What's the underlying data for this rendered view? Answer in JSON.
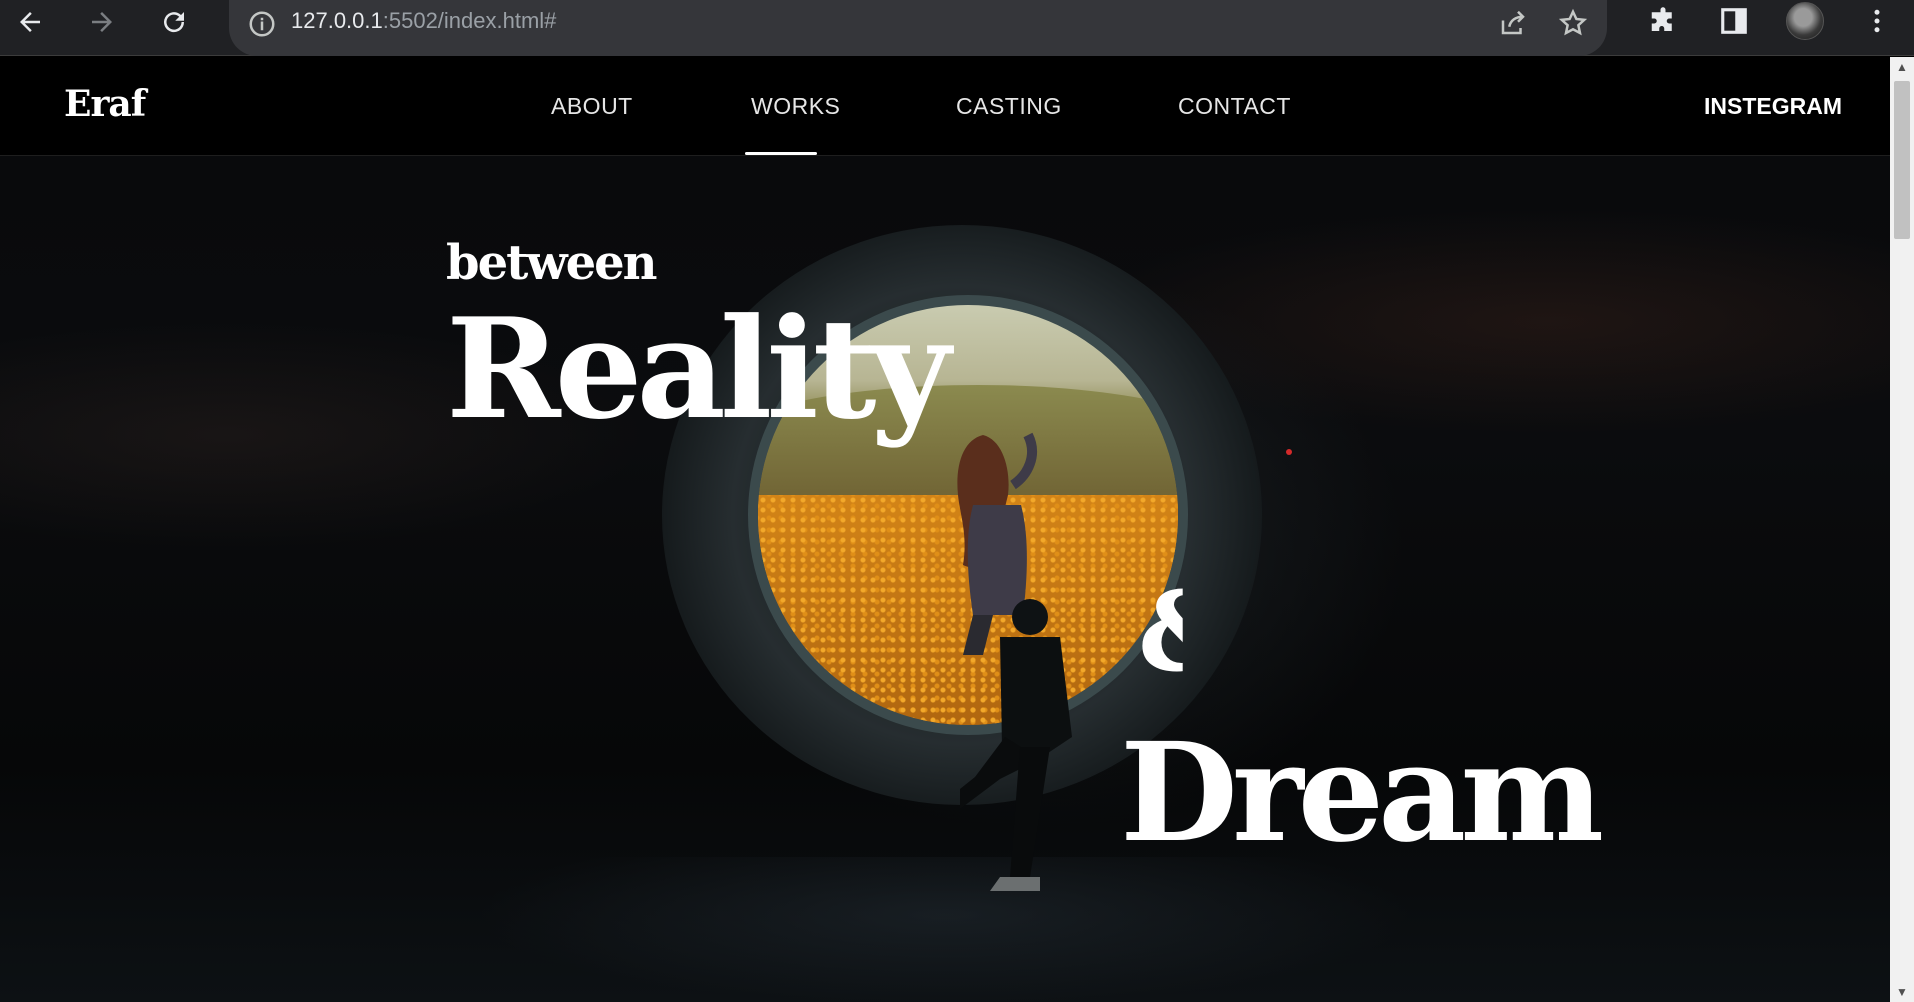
{
  "browser": {
    "url_host": "127.0.0.1",
    "url_rest": ":5502/index.html#",
    "icons": [
      "back-icon",
      "forward-icon",
      "reload-icon",
      "info-icon",
      "share-icon",
      "star-icon",
      "extensions-icon",
      "sidepanel-icon",
      "profile-avatar",
      "menu-icon"
    ]
  },
  "site": {
    "logo": "Eraf",
    "nav": [
      {
        "label": "ABOUT"
      },
      {
        "label": "WORKS",
        "active": true
      },
      {
        "label": "CASTING"
      },
      {
        "label": "CONTACT"
      }
    ],
    "instagram": "INSTEGRAM"
  },
  "hero": {
    "between": "between",
    "reality": "Reality",
    "ampersand": "&",
    "dream": "Dream"
  },
  "colors": {
    "page_bg": "#050608",
    "chrome_bg": "#202124",
    "omnibox_bg": "#35363a",
    "accent_dot": "#d52a2a",
    "text": "#ffffff"
  }
}
